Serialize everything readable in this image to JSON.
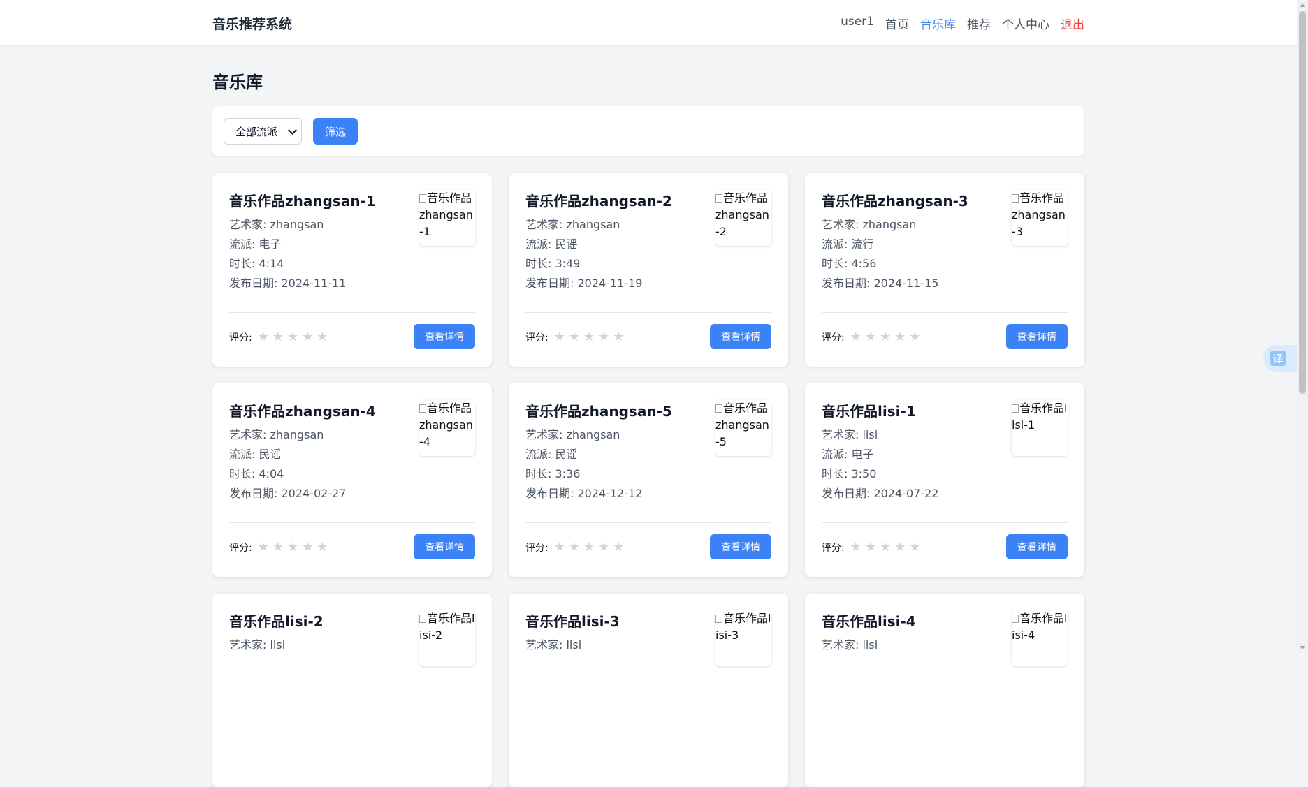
{
  "nav": {
    "brand": "音乐推荐系统",
    "links": [
      "user1",
      "首页",
      "音乐库",
      "推荐",
      "个人中心",
      "退出"
    ],
    "active_link": "音乐库"
  },
  "page": {
    "title": "音乐库"
  },
  "filter": {
    "genre_selected": "全部流派",
    "submit_label": "筛选"
  },
  "labels": {
    "artist": "艺术家: ",
    "genre": "流派: ",
    "duration": "时长: ",
    "release": "发布日期: ",
    "rating": "评分:",
    "detail_button": "查看详情"
  },
  "songs": [
    {
      "title": "音乐作品zhangsan-1",
      "artist": "zhangsan",
      "genre": "电子",
      "duration": "4:14",
      "release": "2024-11-11",
      "cover_alt": "音乐作品zhangsan-1",
      "rating": 0
    },
    {
      "title": "音乐作品zhangsan-2",
      "artist": "zhangsan",
      "genre": "民谣",
      "duration": "3:49",
      "release": "2024-11-19",
      "cover_alt": "音乐作品zhangsan-2",
      "rating": 0
    },
    {
      "title": "音乐作品zhangsan-3",
      "artist": "zhangsan",
      "genre": "流行",
      "duration": "4:56",
      "release": "2024-11-15",
      "cover_alt": "音乐作品zhangsan-3",
      "rating": 0
    },
    {
      "title": "音乐作品zhangsan-4",
      "artist": "zhangsan",
      "genre": "民谣",
      "duration": "4:04",
      "release": "2024-02-27",
      "cover_alt": "音乐作品zhangsan-4",
      "rating": 0
    },
    {
      "title": "音乐作品zhangsan-5",
      "artist": "zhangsan",
      "genre": "民谣",
      "duration": "3:36",
      "release": "2024-12-12",
      "cover_alt": "音乐作品zhangsan-5",
      "rating": 0
    },
    {
      "title": "音乐作品lisi-1",
      "artist": "lisi",
      "genre": "电子",
      "duration": "3:50",
      "release": "2024-07-22",
      "cover_alt": "音乐作品lisi-1",
      "rating": 0
    },
    {
      "title": "音乐作品lisi-2",
      "artist": "lisi",
      "cover_alt": "音乐作品lisi-2"
    },
    {
      "title": "音乐作品lisi-3",
      "artist": "lisi",
      "cover_alt": "音乐作品lisi-3"
    },
    {
      "title": "音乐作品lisi-4",
      "artist": "lisi",
      "cover_alt": "音乐作品lisi-4"
    }
  ],
  "translate_button": "译",
  "colors": {
    "primary": "#3b82f6",
    "logout": "#ef4444",
    "star_empty": "#d1d5db"
  }
}
